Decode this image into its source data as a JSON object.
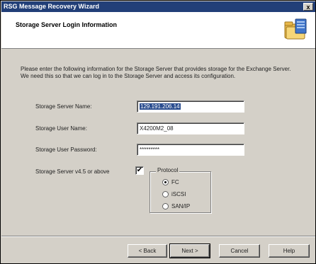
{
  "window": {
    "title": "RSG Message Recovery Wizard",
    "close_glyph": "x"
  },
  "header": {
    "title": "Storage Server Login Information",
    "icon": "folder-server-icon"
  },
  "intro": "Please enter the following information for the Storage Server that provides storage for the Exchange Server.  We need this so that we can log in to the Storage Server and access its configuration.",
  "form": {
    "server_name_label": "Storage Server Name:",
    "server_name_value": "129.191.206.14",
    "user_name_label": "Storage User Name:",
    "user_name_value": "X4200M2_08",
    "password_label": "Storage User Password:",
    "password_value": "*********",
    "version_label": "Storage Server v4.5 or above",
    "version_checked": true,
    "version_check_glyph": "✔"
  },
  "protocol": {
    "title": "Protocol",
    "options": [
      {
        "label": "FC",
        "selected": true
      },
      {
        "label": "iSCSI",
        "selected": false
      },
      {
        "label": "SAN/IP",
        "selected": false
      }
    ]
  },
  "buttons": {
    "back": "< Back",
    "next": "Next >",
    "cancel": "Cancel",
    "help": "Help"
  },
  "colors": {
    "titlebar": "#223f78",
    "face": "#d4d0c8",
    "selection": "#2a4d8f"
  }
}
